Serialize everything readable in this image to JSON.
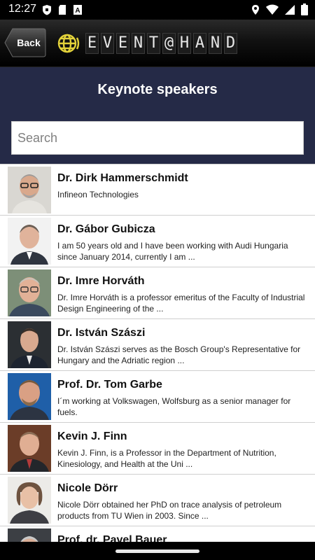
{
  "status_bar": {
    "time": "12:27",
    "left_icons": [
      "shield-icon",
      "sd-card-icon",
      "text-a-icon"
    ],
    "right_icons": [
      "location-icon",
      "wifi-icon",
      "signal-icon",
      "battery-icon"
    ]
  },
  "header": {
    "back_label": "Back",
    "logo_text": [
      "E",
      "V",
      "E",
      "N",
      "T",
      "@",
      "H",
      "A",
      "N",
      "D"
    ],
    "logo_icon": "audio-globe-icon"
  },
  "title_band": {
    "title": "Keynote speakers",
    "search_placeholder": "Search"
  },
  "speakers": [
    {
      "name": "Dr. Dirk Hammerschmidt",
      "desc": "Infineon Technologies"
    },
    {
      "name": "Dr. Gábor Gubicza",
      "desc": "I am 50 years old and I have been working with Audi Hungaria since January 2014, currently I am  ..."
    },
    {
      "name": "Dr. Imre Horváth",
      "desc": "Dr. Imre Horváth is a professor emeritus of the Faculty of Industrial Design Engineering of the  ..."
    },
    {
      "name": "Dr. István Szászi",
      "desc": "Dr. István Szászi serves as the Bosch Group's Representative for Hungary and the Adriatic region ..."
    },
    {
      "name": "Prof. Dr. Tom Garbe",
      "desc": "I´m working at Volkswagen, Wolfsburg as a senior manager for fuels."
    },
    {
      "name": "Kevin J. Finn",
      "desc": "Kevin J. Finn, is a Professor in the Department of Nutrition, Kinesiology, and Health at the Uni ..."
    },
    {
      "name": "Nicole Dörr",
      "desc": "Nicole Dörr obtained her PhD on trace analysis of petroleum products from TU Wien in 2003. Since ..."
    },
    {
      "name": "Prof. dr. Pavel Bauer",
      "desc": ""
    }
  ],
  "colors": {
    "title_band": "#252a47",
    "logo_icon": "#e3d23a"
  }
}
